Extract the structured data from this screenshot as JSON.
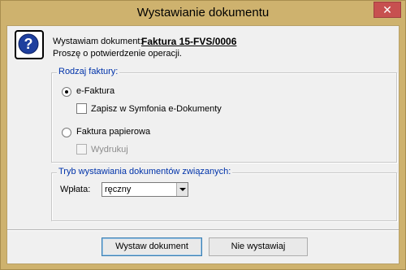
{
  "window": {
    "title": "Wystawianie dokumentu",
    "close_symbol": "✕"
  },
  "header": {
    "doc_label": "Wystawiam dokument:",
    "doc_value": "Faktura 15-FVS/0006",
    "confirm_text": "Proszę o potwierdzenie operacji.",
    "icon": "question-icon"
  },
  "invoice_type": {
    "legend": "Rodzaj faktury:",
    "efaktura_label": "e-Faktura",
    "efaktura_selected": true,
    "save_edocs_label": "Zapisz w Symfonia e-Dokumenty",
    "paper_label": "Faktura papierowa",
    "paper_selected": false,
    "print_label": "Wydrukuj"
  },
  "related_docs": {
    "legend": "Tryb wystawiania dokumentów związanych:",
    "payment_label": "Wpłata:",
    "payment_value": "ręczny"
  },
  "buttons": {
    "issue_label": "Wystaw dokument",
    "dont_issue_label": "Nie wystawiaj"
  },
  "colors": {
    "titlebar": "#ceb26e",
    "close_button": "#c75050",
    "group_legend": "#0033aa",
    "client_background": "#f0f0f0"
  }
}
